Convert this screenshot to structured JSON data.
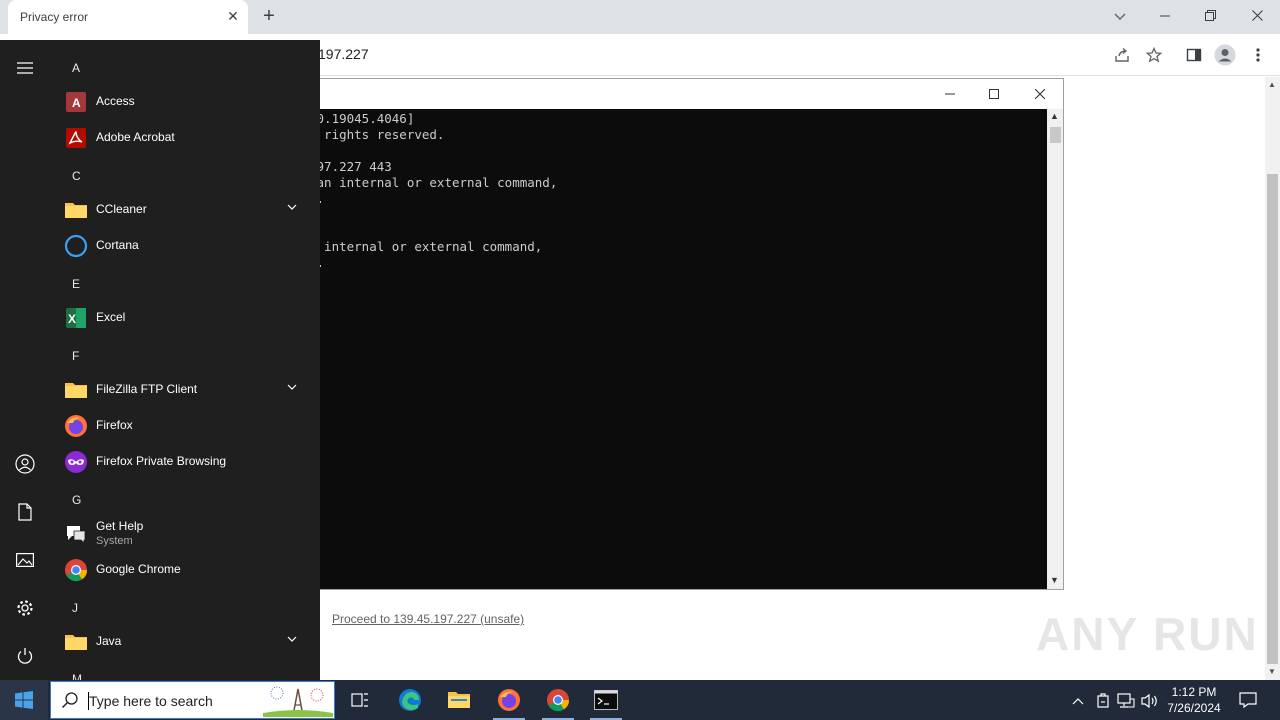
{
  "browser": {
    "tab_title": "Privacy error",
    "address": "197.227",
    "proceed_link": "Proceed to 139.45.197.227 (unsafe)",
    "watermark": "ANY RUN"
  },
  "cmd": {
    "lines": [
      ".0.19045.4046]",
      "l rights reserved.",
      "",
      "197.227 443",
      " an internal or external command,",
      "e.",
      "",
      "",
      "n internal or external command,",
      "e."
    ]
  },
  "start_menu": {
    "letters": {
      "a": "A",
      "c": "C",
      "e": "E",
      "f": "F",
      "g": "G",
      "j": "J",
      "m": "M"
    },
    "apps": {
      "access": "Access",
      "acrobat": "Adobe Acrobat",
      "ccleaner": "CCleaner",
      "cortana": "Cortana",
      "excel": "Excel",
      "filezilla": "FileZilla FTP Client",
      "firefox": "Firefox",
      "firefox_private": "Firefox Private Browsing",
      "get_help": "Get Help",
      "get_help_sub": "System",
      "chrome": "Google Chrome",
      "java": "Java"
    }
  },
  "taskbar": {
    "search_placeholder": "Type here to search",
    "time": "1:12 PM",
    "date": "7/26/2024"
  },
  "colors": {
    "start_bg": "#1f1f1f",
    "taskbar_bg": "#202a38",
    "cmd_bg": "#0c0c0c",
    "chrome_tabstrip": "#dee1e6"
  }
}
